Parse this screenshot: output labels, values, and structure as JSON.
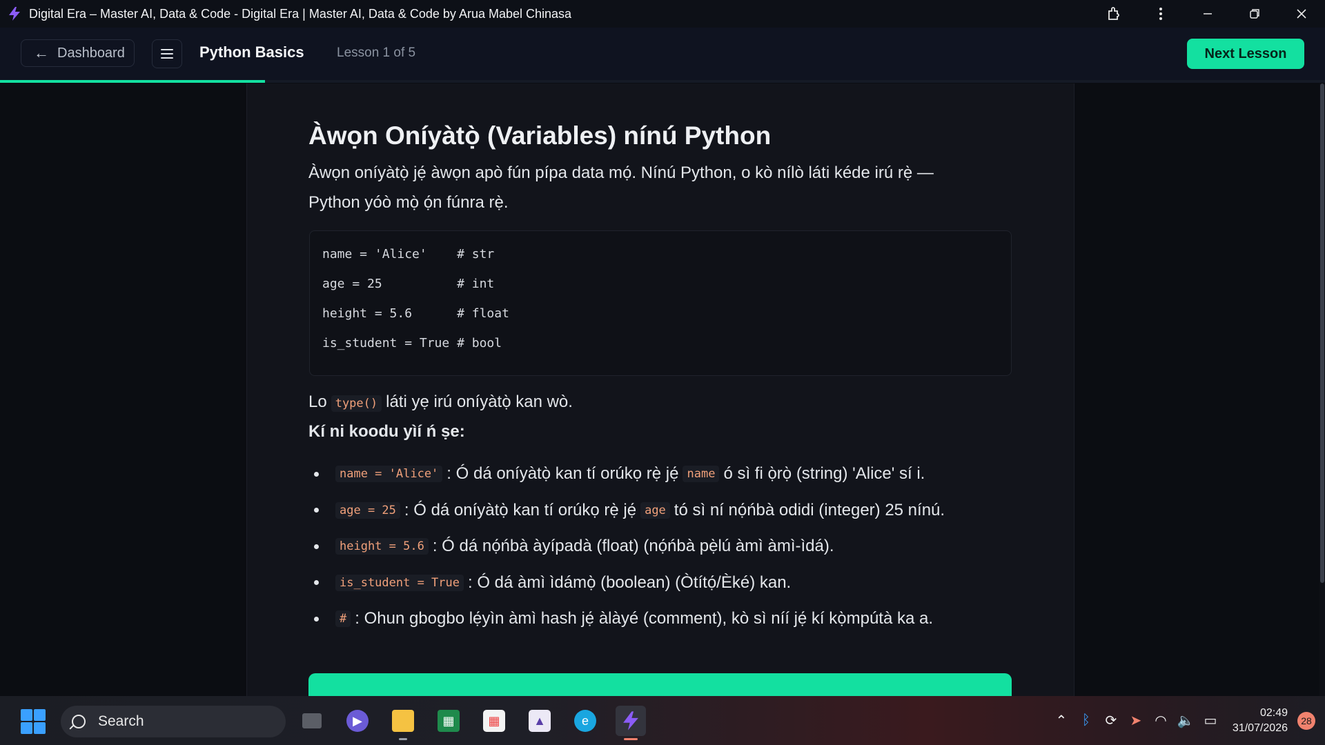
{
  "window": {
    "title": "Digital Era – Master AI, Data & Code - Digital Era | Master AI, Data & Code by Arua Mabel Chinasa",
    "app_icon": "lightning-icon",
    "controls": [
      "extensions-icon",
      "more-icon",
      "minimize-icon",
      "restore-icon",
      "close-icon"
    ]
  },
  "header": {
    "back_label": "Dashboard",
    "course_title": "Python Basics",
    "lesson_count": "Lesson 1 of 5",
    "next_label": "Next Lesson",
    "progress_fraction": 0.2,
    "accent_color": "#13e0a0"
  },
  "lesson": {
    "heading": "Àwọn Oníyàtọ̀ (Variables) nínú Python",
    "intro": "Àwọn oníyàtọ̀ jẹ́ àwọn apò fún pípa data mọ́. Nínú Python, o kò nílò láti kéde irú rẹ̀ — Python yóò mọ̀ ọ́n fúnra rẹ̀.",
    "code_lines": [
      "name = 'Alice'    # str",
      "age = 25          # int",
      "height = 5.6      # float",
      "is_student = True # bool"
    ],
    "type_para": {
      "before": "Lo",
      "code": "type()",
      "after": "láti yẹ irú oníyàtọ̀ kan wò."
    },
    "explain_heading": "Kí ni koodu yìí ń ṣe:",
    "bullets": [
      {
        "code": "name = 'Alice'",
        "text": ": Ó dá oníyàtọ̀ kan tí orúkọ rẹ̀ jẹ́",
        "code2": "name",
        "text2": "ó sì fi ọ̀rọ̀ (string) 'Alice' sí i."
      },
      {
        "code": "age = 25",
        "text": ": Ó dá oníyàtọ̀ kan tí orúkọ rẹ̀ jẹ́",
        "code2": "age",
        "text2": "tó sì ní nọ́ńbà odidi (integer) 25 nínú."
      },
      {
        "code": "height = 5.6",
        "text": ": Ó dá nọ́ńbà àyípadà (float) (nọ́ńbà pẹ̀lú àmì àmì-ìdá).",
        "code2": "",
        "text2": ""
      },
      {
        "code": "is_student = True",
        "text": ": Ó dá àmì ìdámọ̀ (boolean) (Òtítọ́/Èké) kan.",
        "code2": "",
        "text2": ""
      },
      {
        "code": "#",
        "text": ": Ohun gbogbo lẹ́yìn àmì hash jẹ́ àlàyé (comment), kò sì níí jẹ́ kí kọ̀mpútà ka a.",
        "code2": "",
        "text2": ""
      }
    ]
  },
  "taskbar": {
    "search_label": "Search",
    "apps": [
      "task-view-icon",
      "meet-icon",
      "file-explorer-icon",
      "spreadsheet-icon",
      "store-icon",
      "classroom-icon",
      "edge-icon",
      "digital-era-icon"
    ],
    "tray": [
      "chevron-up-icon",
      "bluetooth-icon",
      "sync-icon",
      "location-icon",
      "wifi-icon",
      "volume-icon",
      "battery-icon"
    ],
    "time": "02:49",
    "date": "31/07/2026",
    "notifications": "28"
  }
}
